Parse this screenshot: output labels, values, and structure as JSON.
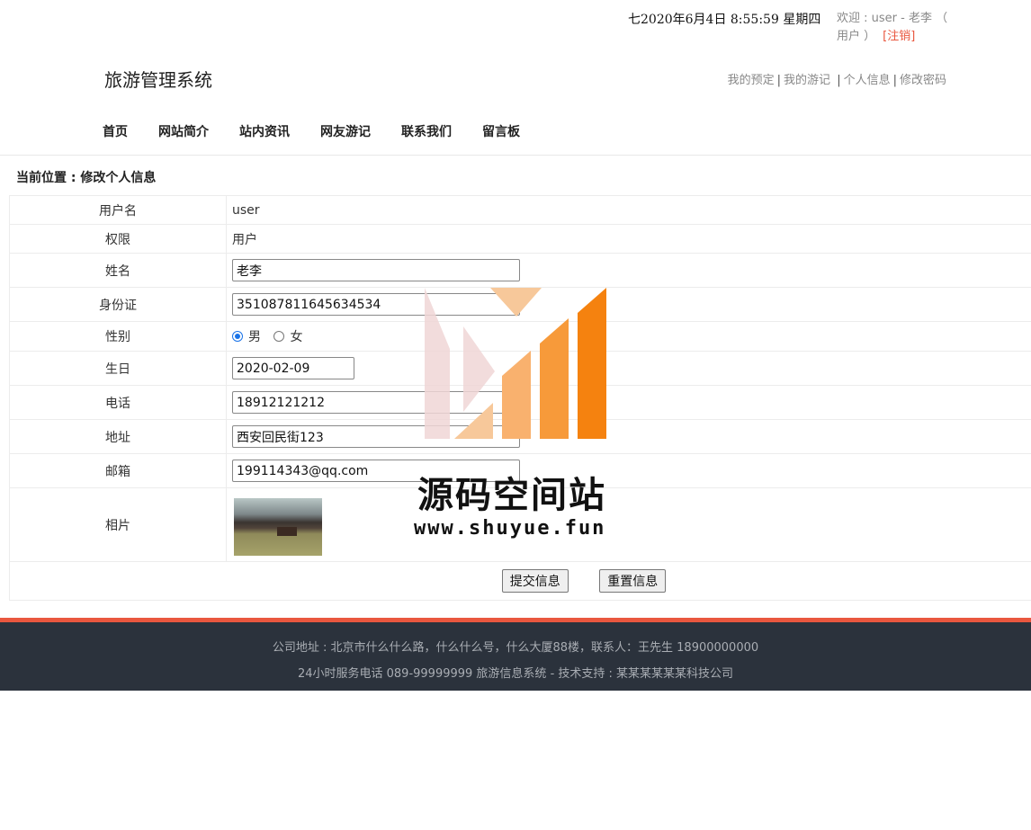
{
  "header": {
    "datetime": "七2020年6月4日 8:55:59 星期四",
    "welcome_prefix": "欢迎 : user - 老李 （ 用户 ）",
    "logout": "[注销]",
    "brand": "旅游管理系统",
    "links": [
      "我的预定",
      "我的游记",
      "个人信息",
      "修改密码"
    ]
  },
  "nav": [
    "首页",
    "网站简介",
    "站内资讯",
    "网友游记",
    "联系我们",
    "留言板"
  ],
  "breadcrumb": "当前位置 : 修改个人信息",
  "form": {
    "username_label": "用户名",
    "username": "user",
    "role_label": "权限",
    "role": "用户",
    "name_label": "姓名",
    "name": "老李",
    "idcard_label": "身份证",
    "idcard": "351087811645634534",
    "gender_label": "性别",
    "gender_male": "男",
    "gender_female": "女",
    "gender_selected": "男",
    "birthday_label": "生日",
    "birthday": "2020-02-09",
    "phone_label": "电话",
    "phone": "18912121212",
    "address_label": "地址",
    "address": "西安回民街123",
    "email_label": "邮箱",
    "email": "199114343@qq.com",
    "photo_label": "相片",
    "submit": "提交信息",
    "reset": "重置信息"
  },
  "watermark": {
    "title": "源码空间站",
    "url": "www.shuyue.fun"
  },
  "footer": {
    "line1": "公司地址 : 北京市什么什么路，什么什么号，什么大厦88楼，联系人：王先生 18900000000",
    "line2": "24小时服务电话   089-99999999   旅游信息系统 - 技术支持 : 某某某某某某科技公司"
  },
  "colors": {
    "accent": "#e9573f",
    "footer_bg": "#2b323c",
    "radio": "#1a73e8"
  }
}
